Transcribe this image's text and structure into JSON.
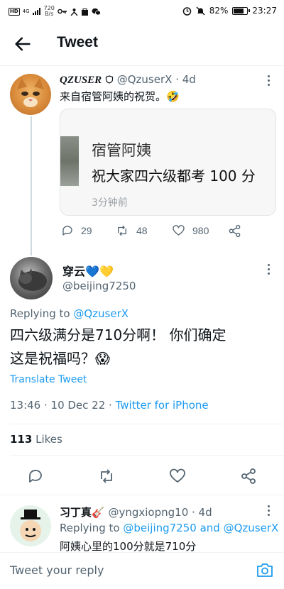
{
  "status_bar": {
    "network": "HD",
    "signal": "4G",
    "speed": "720",
    "speed_unit": "B/s",
    "battery": "82%",
    "time": "23:27",
    "battery_level": 0.82
  },
  "header": {
    "title": "Tweet"
  },
  "parent_tweet": {
    "display_name": "QZUSER",
    "handle": "@QzuserX",
    "time": "· 4d",
    "text": "来自宿管阿姨的祝贺。🤣",
    "quote": {
      "title": "宿管阿姨",
      "message": "祝大家四六级都考 100 分",
      "time": "3分钟前"
    },
    "replies": "29",
    "retweets": "48",
    "likes": "980"
  },
  "main_tweet": {
    "display_name": "穿云",
    "name_emoji": "💙💛",
    "handle": "@beijing7250",
    "replying_label": "Replying to",
    "replying_to": "@QzuserX",
    "text_line1": "四六级满分是710分啊！ 你们确定",
    "text_line2": "这是祝福吗？😱",
    "translate": "Translate Tweet",
    "meta": "13:46 · 10 Dec 22 · ",
    "source": "Twitter for iPhone",
    "likes_count": "113",
    "likes_label": "Likes"
  },
  "reply": {
    "display_name": "习丁真🎸",
    "handle": "@yngxiopng10",
    "time": "· 4d",
    "replying_label": "Replying to",
    "replying_to_1": "@beijing7250",
    "and": "and",
    "replying_to_2": "@QzuserX",
    "text": "阿姨心里的100分就是710分"
  },
  "compose": {
    "placeholder": "Tweet your reply"
  },
  "colors": {
    "accent": "#1d9bf0",
    "text": "#0f1419",
    "muted": "#536471",
    "divider": "#eff3f4"
  }
}
